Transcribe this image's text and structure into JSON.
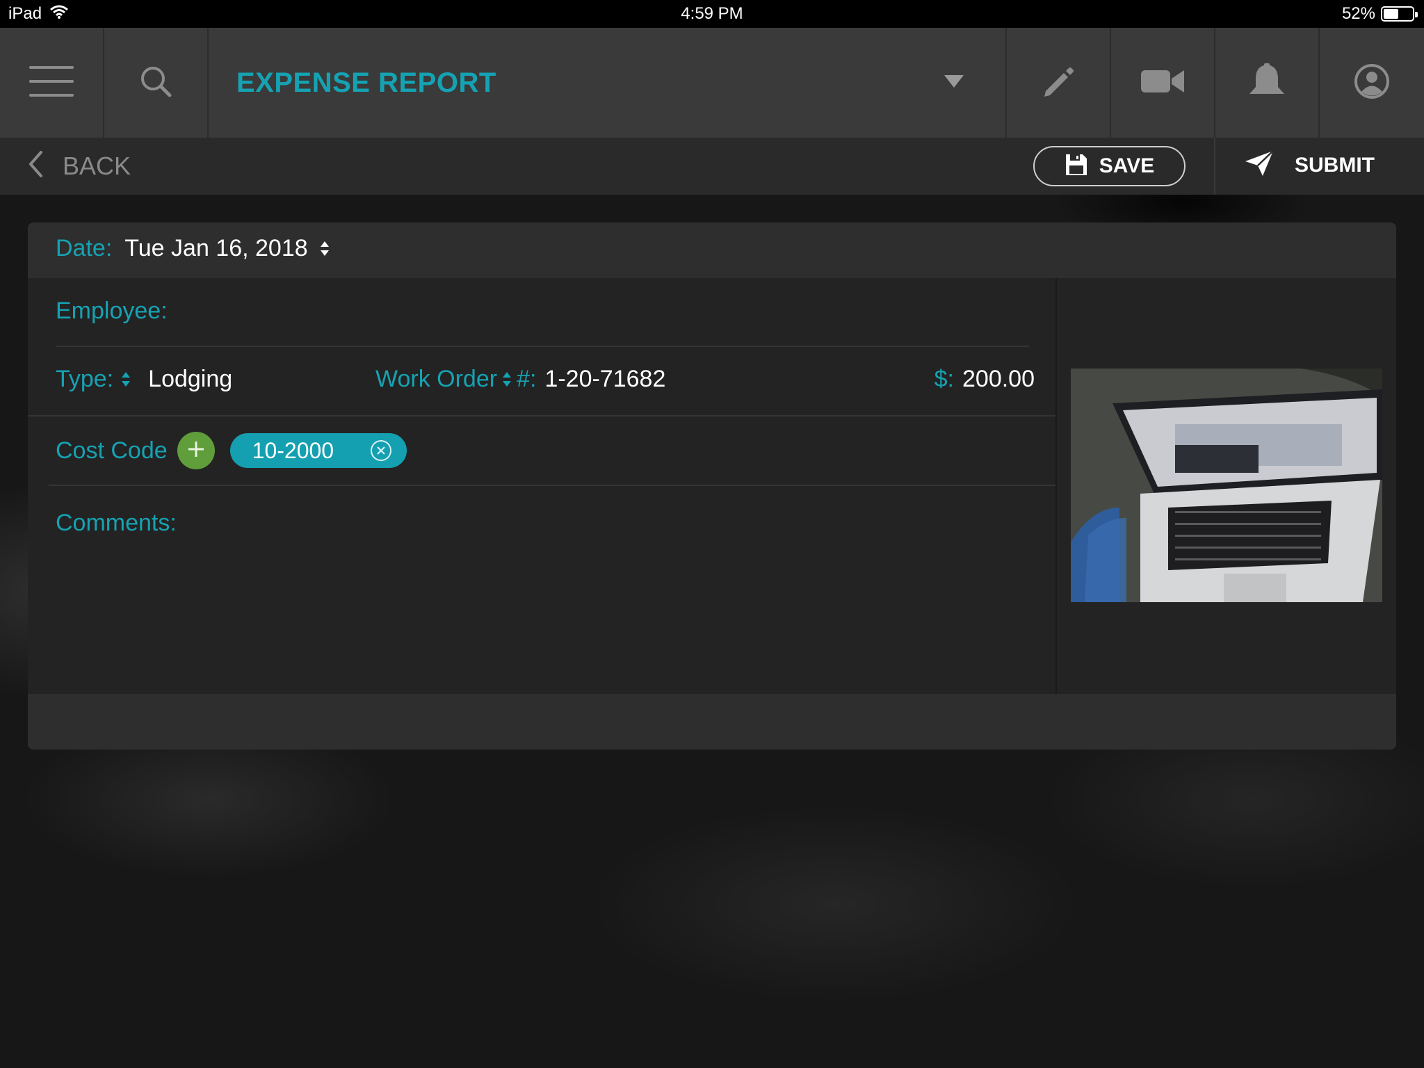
{
  "status_bar": {
    "device": "iPad",
    "time": "4:59 PM",
    "battery_text": "52%",
    "battery_level": 0.52
  },
  "nav": {
    "title": "EXPENSE REPORT",
    "icons": [
      "menu-icon",
      "search-icon",
      "dropdown-arrow-icon",
      "pencil-icon",
      "video-camera-icon",
      "bell-icon",
      "user-profile-icon"
    ]
  },
  "actions": {
    "back_label": "BACK",
    "save_label": "SAVE",
    "submit_label": "SUBMIT"
  },
  "form": {
    "date_label": "Date:",
    "date_value": "Tue Jan 16, 2018",
    "employee_label": "Employee:",
    "employee_value": "",
    "type_label": "Type:",
    "type_value": "Lodging",
    "work_order_label": "Work Order",
    "work_order_hash": "#:",
    "work_order_value": "1-20-71682",
    "amount_label": "$:",
    "amount_value": "200.00",
    "cost_code_label": "Cost Code",
    "cost_code_chip": "10-2000",
    "comments_label": "Comments:"
  },
  "colors": {
    "accent": "#15a3b3",
    "add_green": "#5f9e3a",
    "nav_bg": "#3a3a3a",
    "card_bg": "#232323"
  }
}
